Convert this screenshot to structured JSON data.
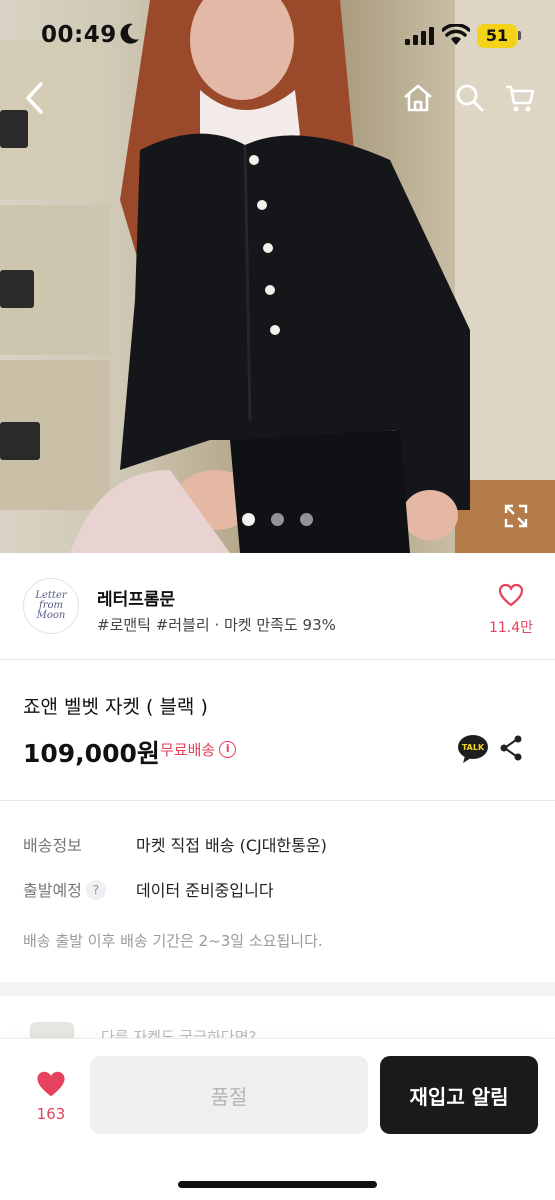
{
  "status_bar": {
    "time": "00:49",
    "battery": "51"
  },
  "seller": {
    "logo_text": "Letter from Moon",
    "name": "레터프롬문",
    "tags": "#로맨틱 #러블리 · 마켓 만족도 93%",
    "like_count": "11.4만"
  },
  "product": {
    "name": "죠앤 벨벳 자켓 ( 블랙 )",
    "price": "109,000원",
    "shipping_badge": "무료배송",
    "talk_label": "TALK"
  },
  "delivery": {
    "rows": [
      {
        "label": "배송정보",
        "value": "마켓 직접 배송 (CJ대한통운)"
      },
      {
        "label": "출발예정",
        "value": "데이터 준비중입니다"
      }
    ],
    "note": "배송 출발 이후 배송 기간은 2~3일 소요됩니다."
  },
  "peek": {
    "text": "다른 자켓도 궁금하다면?"
  },
  "bottom_bar": {
    "like_count": "163",
    "soldout_label": "품절",
    "restock_label": "재입고 알림"
  },
  "carousel": {
    "pages": 3,
    "active": 1
  },
  "colors": {
    "accent": "#e5425e",
    "dark_button": "#1a1a1a"
  },
  "icons": [
    "back-icon",
    "home-icon",
    "search-icon",
    "cart-icon",
    "expand-icon",
    "heart-icon",
    "talk-icon",
    "share-icon",
    "info-icon",
    "question-icon"
  ]
}
